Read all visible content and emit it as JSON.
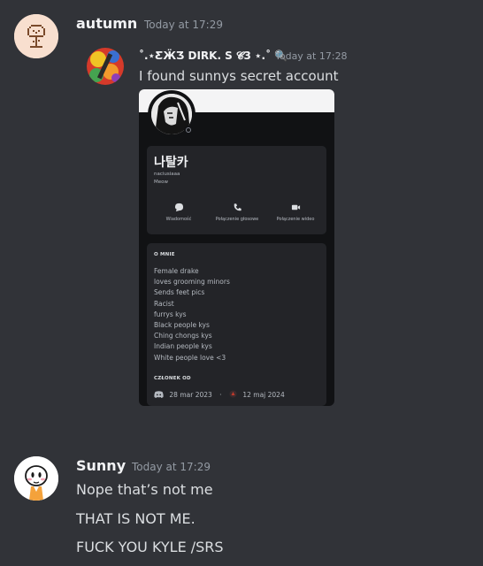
{
  "messages": [
    {
      "author": "autumn",
      "timestamp": "Today at 17:29",
      "avatar_icon": "tree-pixel-avatar"
    },
    {
      "author": "Sunny",
      "timestamp": "Today at 17:29",
      "avatar_icon": "cartoon-character-avatar",
      "lines": [
        "Nope that’s not me",
        "THAT IS NOT ME.",
        "FUCK YOU KYLE /SRS"
      ]
    }
  ],
  "reply": {
    "author": "˚.⋆ƸӜƷ DIRK. S 𝓒3 ⋆.˚ 🔍",
    "timestamp": "Today at 17:28",
    "text": "I found sunnys secret account"
  },
  "screenshot": {
    "display_name": "나탈카",
    "username": "naciusiaaa",
    "pronouns": "Meow",
    "actions": [
      "Wiadomość",
      "Połączenie głosowe",
      "Połączenie wideo"
    ],
    "about_header": "O MNIE",
    "bio_lines": [
      "Female drake",
      "loves grooming minors",
      "Sends feet pics",
      "Racist",
      "furrys kys",
      "Black people kys",
      "Ching chongs kys",
      "Indian people kys",
      "White people love <3"
    ],
    "member_header": "CZŁONEK OD",
    "member_discord_date": "28 mar 2023",
    "member_separator": "·",
    "member_server_date": "12 maj 2024"
  }
}
